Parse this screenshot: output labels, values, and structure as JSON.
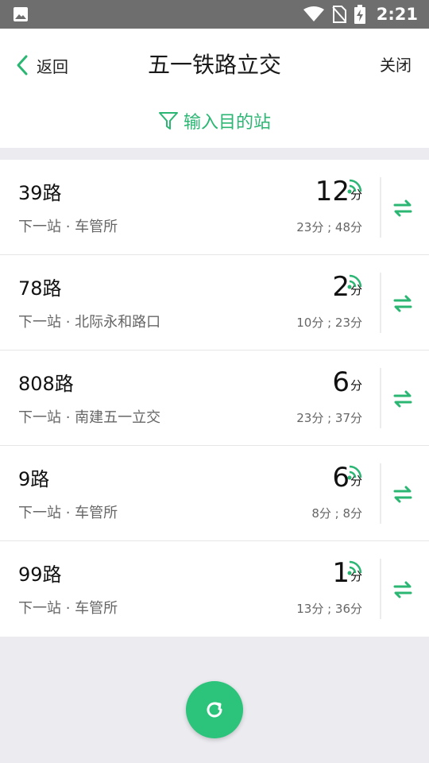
{
  "status_bar": {
    "time": "2:21",
    "icons": [
      "image-icon",
      "wifi-icon",
      "no-sim-icon",
      "battery-charging-icon"
    ]
  },
  "header": {
    "back_label": "返回",
    "title": "五一铁路立交",
    "close_label": "关闭",
    "filter_label": "输入目的站"
  },
  "colors": {
    "accent": "#2bb673",
    "refresh_bg": "#2bc47a",
    "status_bar": "#6e6e6e",
    "page_bg": "#ebebf0"
  },
  "routes": [
    {
      "name": "39路",
      "next_stop": "下一站 · 车管所",
      "eta": "12",
      "unit": "分",
      "realtime": true,
      "upcoming": "23分 ; 48分"
    },
    {
      "name": "78路",
      "next_stop": "下一站 · 北际永和路口",
      "eta": "2",
      "unit": "分",
      "realtime": true,
      "upcoming": "10分 ; 23分"
    },
    {
      "name": "808路",
      "next_stop": "下一站 · 南建五一立交",
      "eta": "6",
      "unit": "分",
      "realtime": false,
      "upcoming": "23分 ; 37分"
    },
    {
      "name": "9路",
      "next_stop": "下一站 · 车管所",
      "eta": "6",
      "unit": "分",
      "realtime": true,
      "upcoming": "8分 ; 8分"
    },
    {
      "name": "99路",
      "next_stop": "下一站 · 车管所",
      "eta": "1",
      "unit": "分",
      "realtime": true,
      "upcoming": "13分 ; 36分"
    }
  ]
}
